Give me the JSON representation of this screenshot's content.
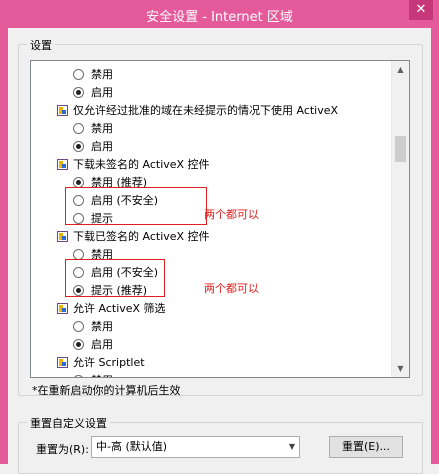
{
  "window": {
    "title": "安全设置 - Internet 区域",
    "close_label": "✕"
  },
  "settings_group": {
    "label": "设置"
  },
  "list_rows": [
    {
      "type": "radio",
      "checked": false,
      "label": "禁用"
    },
    {
      "type": "radio",
      "checked": true,
      "label": "启用"
    },
    {
      "type": "category",
      "label": "仅允许经过批准的域在未经提示的情况下使用 ActiveX"
    },
    {
      "type": "radio",
      "checked": false,
      "label": "禁用"
    },
    {
      "type": "radio",
      "checked": true,
      "label": "启用"
    },
    {
      "type": "category",
      "label": "下载未签名的 ActiveX 控件"
    },
    {
      "type": "radio",
      "checked": true,
      "label": "禁用 (推荐)"
    },
    {
      "type": "radio",
      "checked": false,
      "label": "启用 (不安全)"
    },
    {
      "type": "radio",
      "checked": false,
      "label": "提示"
    },
    {
      "type": "category",
      "label": "下载已签名的 ActiveX 控件"
    },
    {
      "type": "radio",
      "checked": false,
      "label": "禁用"
    },
    {
      "type": "radio",
      "checked": false,
      "label": "启用 (不安全)"
    },
    {
      "type": "radio",
      "checked": true,
      "label": "提示 (推荐)"
    },
    {
      "type": "category",
      "label": "允许 ActiveX 筛选"
    },
    {
      "type": "radio",
      "checked": false,
      "label": "禁用"
    },
    {
      "type": "radio",
      "checked": true,
      "label": "启用"
    },
    {
      "type": "category",
      "label": "允许 Scriptlet"
    },
    {
      "type": "radio",
      "checked": true,
      "label": "禁用"
    }
  ],
  "annotations": {
    "first": "两个都可以",
    "second": "两个都可以"
  },
  "note": "*在重新启动你的计算机后生效",
  "reset_group": {
    "label": "重置自定义设置",
    "reset_to_label": "重置为(R):",
    "select_value": "中-高 (默认值)",
    "reset_button": "重置(E)..."
  },
  "colors": {
    "accent": "#e55a9b",
    "annotation": "#e02020"
  }
}
